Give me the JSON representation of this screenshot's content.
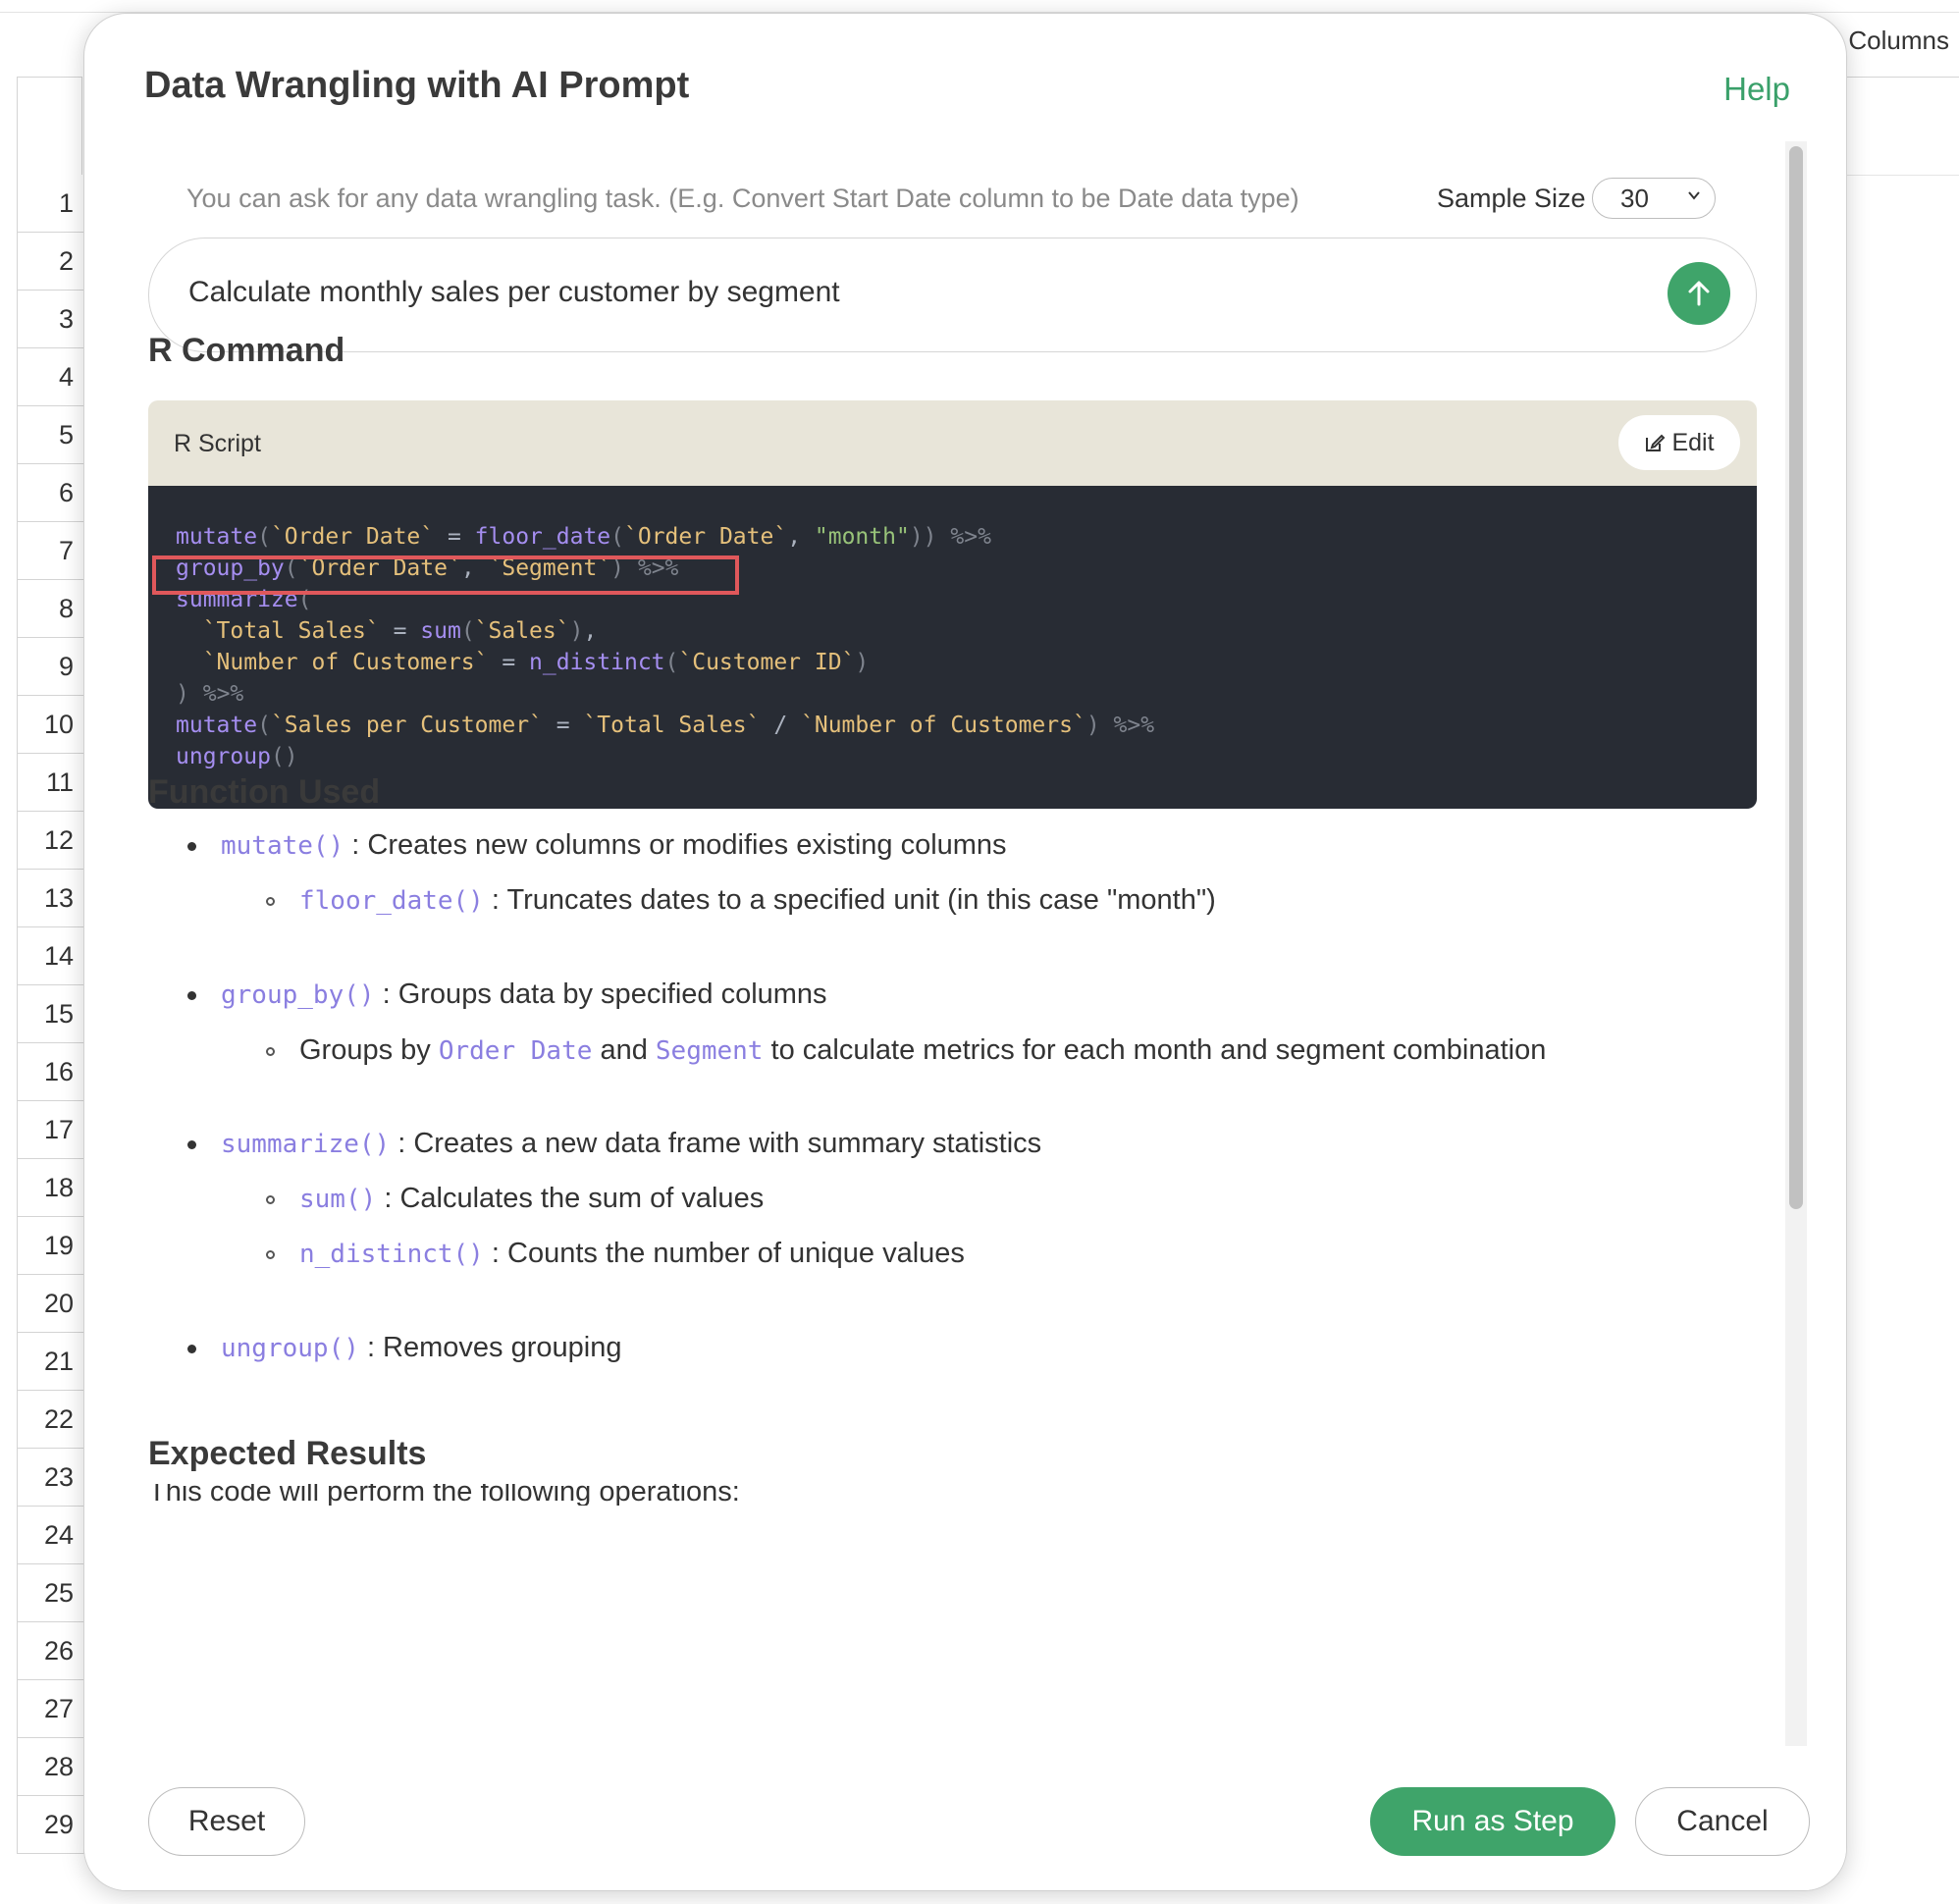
{
  "background": {
    "columns_label": "Columns",
    "row_numbers": [
      "1",
      "2",
      "3",
      "4",
      "5",
      "6",
      "7",
      "8",
      "9",
      "10",
      "11",
      "12",
      "13",
      "14",
      "15",
      "16",
      "17",
      "18",
      "19",
      "20",
      "21",
      "22",
      "23",
      "24",
      "25",
      "26",
      "27",
      "28",
      "29"
    ]
  },
  "dialog": {
    "title": "Data Wrangling with AI Prompt",
    "help": "Help",
    "hint": "You can ask for any data wrangling task. (E.g. Convert Start Date column to be Date data type)",
    "sample_size_label": "Sample Size",
    "sample_size_value": "30",
    "prompt_value": "Calculate monthly sales per customer by segment",
    "r_command_heading": "R Command",
    "code_header": "R Script",
    "edit_label": "Edit",
    "function_used_heading": "Function Used",
    "functions": {
      "mutate": {
        "code": "mutate()",
        "desc": " : Creates new columns or modifies existing columns"
      },
      "floor_date": {
        "code": "floor_date()",
        "desc": " : Truncates dates to a specified unit (in this case \"month\")"
      },
      "group_by": {
        "code": "group_by()",
        "desc": " : Groups data by specified columns"
      },
      "group_by_detail": {
        "pre": "Groups by ",
        "col1": "Order Date",
        "mid": " and ",
        "col2": "Segment",
        "post": " to calculate metrics for each month and segment combination"
      },
      "summarize": {
        "code": "summarize()",
        "desc": " : Creates a new data frame with summary statistics"
      },
      "sum": {
        "code": "sum()",
        "desc": " : Calculates the sum of values"
      },
      "n_distinct": {
        "code": "n_distinct()",
        "desc": " : Counts the number of unique values"
      },
      "ungroup": {
        "code": "ungroup()",
        "desc": " : Removes grouping"
      }
    },
    "expected_results_heading": "Expected Results",
    "expected_results_text": "This code will perform the following operations:"
  },
  "footer": {
    "reset": "Reset",
    "run": "Run as Step",
    "cancel": "Cancel"
  },
  "colors": {
    "accent": "#3fa46a",
    "code_bg": "#282c34",
    "highlight": "#e0585b"
  }
}
